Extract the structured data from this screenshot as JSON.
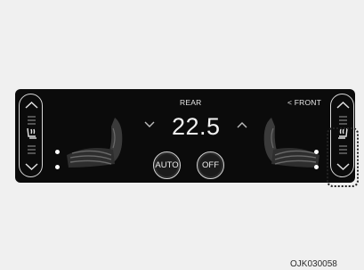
{
  "panel": {
    "rear_label": "REAR",
    "front_label": "< FRONT",
    "temperature": "22.5",
    "auto_label": "AUTO",
    "off_label": "OFF"
  },
  "left_control": {
    "up_icon": "chevron-up-icon",
    "seat_icon": "heated-seat-icon",
    "down_icon": "chevron-down-icon"
  },
  "right_control": {
    "up_icon": "chevron-up-icon",
    "seat_icon": "heated-seat-icon",
    "down_icon": "chevron-down-icon"
  },
  "image_code": "OJK030058"
}
